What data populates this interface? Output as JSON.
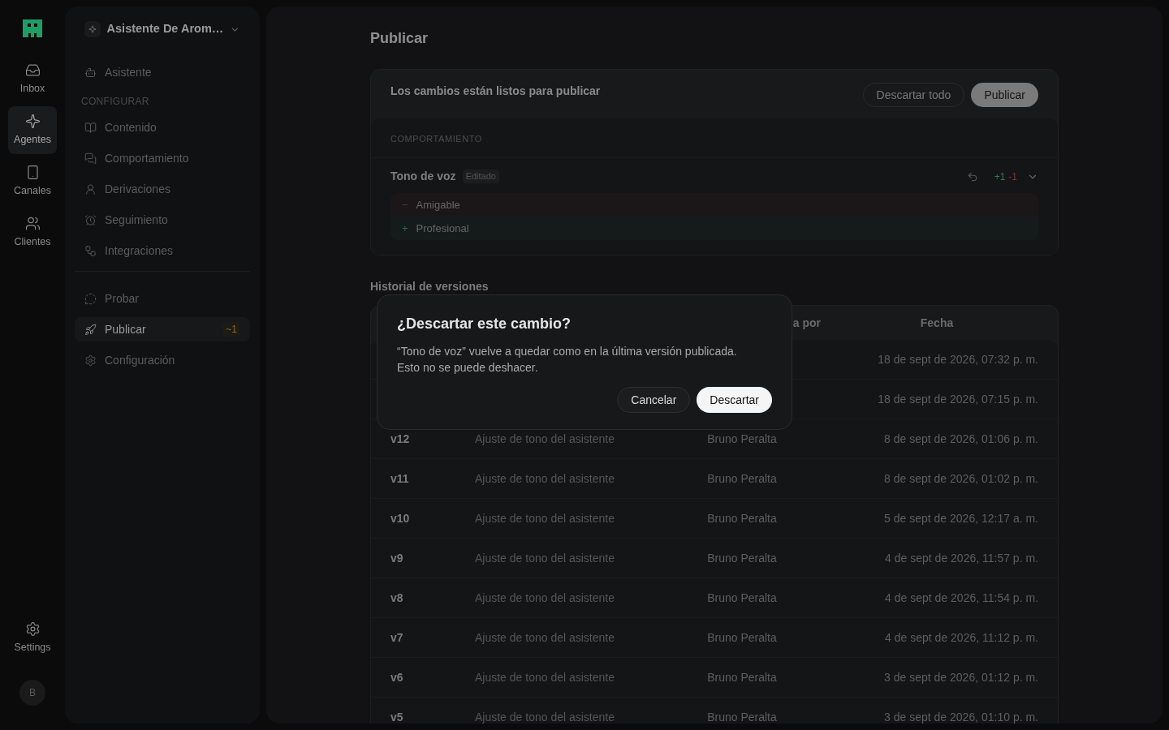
{
  "rail": {
    "items": [
      {
        "label": "Inbox",
        "selected": false
      },
      {
        "label": "Agentes",
        "selected": true
      },
      {
        "label": "Canales",
        "selected": false
      },
      {
        "label": "Clientes",
        "selected": false
      }
    ],
    "settings": {
      "label": "Settings",
      "selected": false
    },
    "avatar": "B"
  },
  "sidebar": {
    "agent": "Asistente De Arom…",
    "groups": [
      {
        "items": [
          {
            "label": "Asistente",
            "selected": false
          }
        ]
      },
      {
        "heading": "CONFIGURAR",
        "items": [
          {
            "label": "Contenido",
            "selected": false
          },
          {
            "label": "Comportamiento",
            "selected": false
          },
          {
            "label": "Derivaciones",
            "selected": false
          },
          {
            "label": "Seguimiento",
            "selected": false
          },
          {
            "label": "Integraciones",
            "selected": false
          }
        ]
      },
      {
        "items": [
          {
            "label": "Probar",
            "selected": false
          },
          {
            "label": "Publicar",
            "selected": true,
            "badge": "~1"
          },
          {
            "label": "Configuración",
            "selected": false
          }
        ]
      }
    ]
  },
  "page": {
    "title": "Publicar",
    "changes": {
      "message": "Los cambios están listos para publicar",
      "buttons": [
        "Descartar todo",
        "Publicar"
      ],
      "section": "COMPORTAMIENTO",
      "field": {
        "name": "Tono de voz",
        "tag": "Editado",
        "added": "+1",
        "removed": "-1",
        "expanded": true,
        "diff": [
          {
            "kind": "removed",
            "sign": "−",
            "text": "Amigable"
          },
          {
            "kind": "added",
            "sign": "+",
            "text": "Profesional"
          }
        ]
      }
    },
    "history": {
      "title": "Historial de versiones",
      "columns": [
        "a por",
        "Fecha"
      ],
      "rows": [
        {
          "date": "18 de sept de 2026, 07:32 p. m."
        },
        {
          "date": "18 de sept de 2026, 07:15 p. m."
        },
        {
          "version": "v12",
          "description": "Ajuste de tono del asistente",
          "author": "Bruno Peralta",
          "date": "8 de sept de 2026, 01:06 p. m."
        },
        {
          "version": "v11",
          "description": "Ajuste de tono del asistente",
          "author": "Bruno Peralta",
          "date": "8 de sept de 2026, 01:02 p. m."
        },
        {
          "version": "v10",
          "description": "Ajuste de tono del asistente",
          "author": "Bruno Peralta",
          "date": "5 de sept de 2026, 12:17 a. m."
        },
        {
          "version": "v9",
          "description": "Ajuste de tono del asistente",
          "author": "Bruno Peralta",
          "date": "4 de sept de 2026, 11:57 p. m."
        },
        {
          "version": "v8",
          "description": "Ajuste de tono del asistente",
          "author": "Bruno Peralta",
          "date": "4 de sept de 2026, 11:54 p. m."
        },
        {
          "version": "v7",
          "description": "Ajuste de tono del asistente",
          "author": "Bruno Peralta",
          "date": "4 de sept de 2026, 11:12 p. m."
        },
        {
          "version": "v6",
          "description": "Ajuste de tono del asistente",
          "author": "Bruno Peralta",
          "date": "3 de sept de 2026, 01:12 p. m."
        },
        {
          "version": "v5",
          "description": "Ajuste de tono del asistente",
          "author": "Bruno Peralta",
          "date": "3 de sept de 2026, 01:10 p. m."
        }
      ]
    }
  },
  "dialog": {
    "title": "¿Descartar este cambio?",
    "message": "“Tono de voz” vuelve a quedar como en la última versión publicada. Esto no se puede deshacer.",
    "buttons": [
      "Cancelar",
      "Descartar"
    ]
  }
}
